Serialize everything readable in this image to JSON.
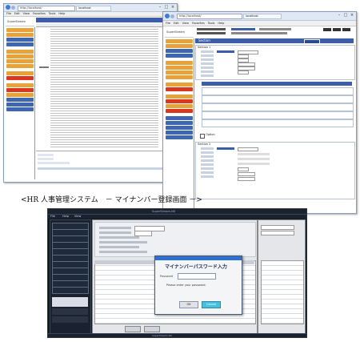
{
  "window1": {
    "title": "SuperStream",
    "address": "http://localhost/",
    "tab": "localhost",
    "menu": [
      "File",
      "Edit",
      "View",
      "Favorites",
      "Tools",
      "Help"
    ]
  },
  "window2": {
    "title": "SuperStream",
    "address": "http://localhost/",
    "tab": "localhost",
    "menu": [
      "File",
      "Edit",
      "View",
      "Favorites",
      "Tools",
      "Help"
    ],
    "header": "Section",
    "section1": "Section 1",
    "section2": "Section 2",
    "checkbox_label": "Option"
  },
  "caption": "<HR 人事管理システム　－ マイナンバー登録画面 －>",
  "window3": {
    "title": "SuperStream-NX",
    "menu": [
      "File",
      "Help",
      "View"
    ],
    "dialog": {
      "title": "マイナンバーパスワード入力",
      "field_label": "Password",
      "message_line1": "Please enter your password.",
      "message_line2": "",
      "ok_label": "OK",
      "cancel_label": "Cancel"
    },
    "status_left": "SuperStream NX",
    "status_right": ""
  },
  "colors": {
    "nav_orange": "#e8a23a",
    "nav_red": "#d9381e",
    "nav_blue": "#3f66b0",
    "header_blue": "#3c5ea8",
    "dark_bg": "#101820",
    "dark_panel": "#2a3442",
    "dialog_title_bg": "#2e6fd0",
    "ok_button_bg": "#48c0dc"
  }
}
